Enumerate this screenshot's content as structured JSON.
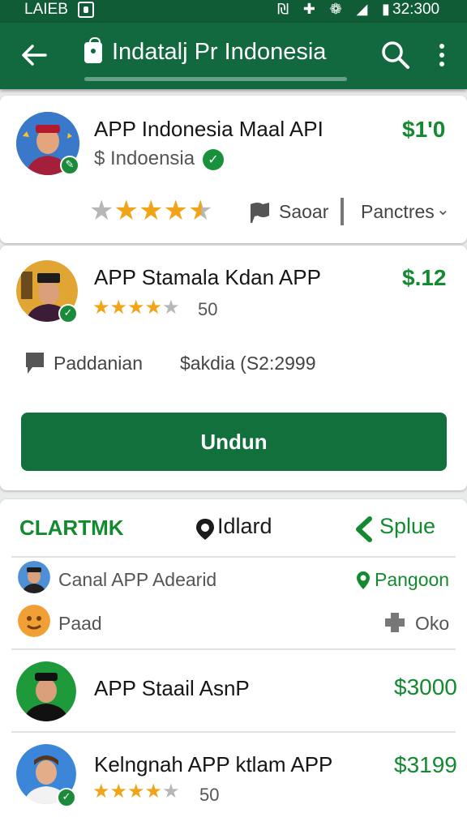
{
  "status_bar": {
    "carrier": "LAIEB",
    "icons": "₪ ✚ ❁ ◢ ▮",
    "time": "32:300"
  },
  "app_bar": {
    "title": "Indatalj Pr Indonesia"
  },
  "featured": {
    "name": "APP Indonesia Maal API",
    "price": "$1'0",
    "publisher": "$ Indoensia",
    "rating_stars": 4.5,
    "stat_label": "Saoar",
    "sort_label": "Panctres",
    "sort_icon": "chevron-down-icon"
  },
  "second": {
    "name": "APP Stamala Kdan APP",
    "price": "$.12",
    "rating_stars": 4,
    "rating_count": "50",
    "category": "Paddanian",
    "price_detail": "$akdia (S2:2999",
    "download_label": "Undun"
  },
  "tabs": {
    "left": "CLARTMK",
    "middle": "Idlard",
    "right": "Splue",
    "accent": "#138a2f"
  },
  "list": {
    "row1_left": "Canal APP Adearid",
    "row1_right": "Pangoon",
    "row2_left": "Paad",
    "row2_right": "Oko",
    "item1_name": "APP Staail AsnP",
    "item1_price": "$3000",
    "item2_name": "Kelngnah APP ktlam APP",
    "item2_price": "$3199",
    "item2_rating_stars": 4,
    "item2_rating_count": "50"
  }
}
